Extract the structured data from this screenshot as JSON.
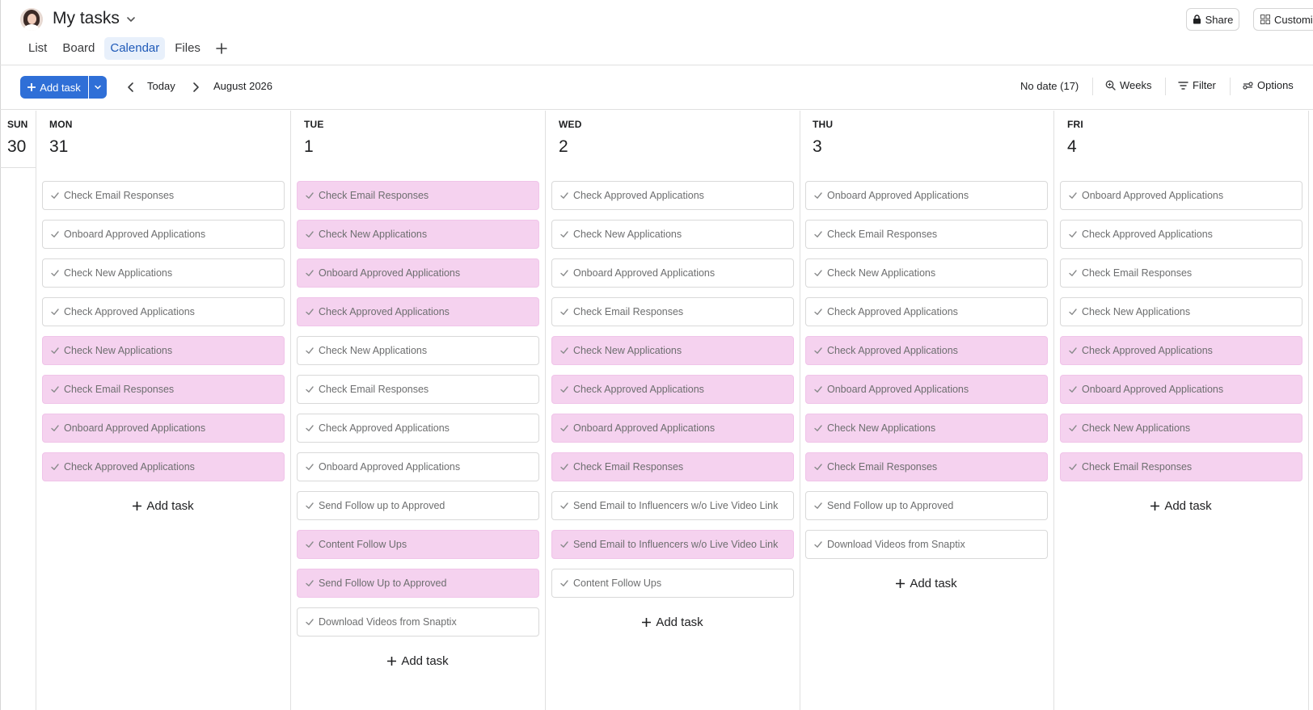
{
  "header": {
    "title": "My tasks",
    "share_label": "Share",
    "customize_label": "Customize"
  },
  "tabs": [
    {
      "label": "List",
      "active": false
    },
    {
      "label": "Board",
      "active": false
    },
    {
      "label": "Calendar",
      "active": true
    },
    {
      "label": "Files",
      "active": false
    }
  ],
  "toolbar": {
    "add_task_label": "Add task",
    "today_label": "Today",
    "month_label": "August 2026",
    "no_date_label": "No date (17)",
    "weeks_label": "Weeks",
    "filter_label": "Filter",
    "options_label": "Options"
  },
  "sunday": {
    "name": "SUN",
    "number": "30"
  },
  "add_task_label": "Add task",
  "colors": {
    "accent": "#2f6fd7",
    "task_highlight": "#f5d2ef",
    "active_tab_bg": "#e8f0fb"
  },
  "days": [
    {
      "name": "MON",
      "number": "31",
      "tasks": [
        {
          "title": "Check Email Responses",
          "highlight": false
        },
        {
          "title": "Onboard Approved Applications",
          "highlight": false
        },
        {
          "title": "Check New Applications",
          "highlight": false
        },
        {
          "title": "Check Approved Applications",
          "highlight": false
        },
        {
          "title": "Check New Applications",
          "highlight": true
        },
        {
          "title": "Check Email Responses",
          "highlight": true
        },
        {
          "title": "Onboard Approved Applications",
          "highlight": true
        },
        {
          "title": "Check Approved Applications",
          "highlight": true
        }
      ]
    },
    {
      "name": "TUE",
      "number": "1",
      "tasks": [
        {
          "title": "Check Email Responses",
          "highlight": true
        },
        {
          "title": "Check New Applications",
          "highlight": true
        },
        {
          "title": "Onboard Approved Applications",
          "highlight": true
        },
        {
          "title": "Check Approved Applications",
          "highlight": true
        },
        {
          "title": "Check New Applications",
          "highlight": false
        },
        {
          "title": "Check Email Responses",
          "highlight": false
        },
        {
          "title": "Check Approved Applications",
          "highlight": false
        },
        {
          "title": "Onboard Approved Applications",
          "highlight": false
        },
        {
          "title": "Send Follow up to Approved",
          "highlight": false
        },
        {
          "title": "Content Follow Ups",
          "highlight": true
        },
        {
          "title": "Send Follow Up to Approved",
          "highlight": true
        },
        {
          "title": "Download Videos from Snaptix",
          "highlight": false
        }
      ]
    },
    {
      "name": "WED",
      "number": "2",
      "tasks": [
        {
          "title": "Check Approved Applications",
          "highlight": false
        },
        {
          "title": "Check New Applications",
          "highlight": false
        },
        {
          "title": "Onboard Approved Applications",
          "highlight": false
        },
        {
          "title": "Check Email Responses",
          "highlight": false
        },
        {
          "title": "Check New Applications",
          "highlight": true
        },
        {
          "title": "Check Approved Applications",
          "highlight": true
        },
        {
          "title": "Onboard Approved Applications",
          "highlight": true
        },
        {
          "title": "Check Email Responses",
          "highlight": true
        },
        {
          "title": "Send Email to Influencers w/o Live Video Link",
          "highlight": false
        },
        {
          "title": "Send Email to Influencers w/o Live Video Link",
          "highlight": true
        },
        {
          "title": "Content Follow Ups",
          "highlight": false
        }
      ]
    },
    {
      "name": "THU",
      "number": "3",
      "tasks": [
        {
          "title": "Onboard Approved Applications",
          "highlight": false
        },
        {
          "title": "Check Email Responses",
          "highlight": false
        },
        {
          "title": "Check New Applications",
          "highlight": false
        },
        {
          "title": "Check Approved Applications",
          "highlight": false
        },
        {
          "title": "Check Approved Applications",
          "highlight": true
        },
        {
          "title": "Onboard Approved Applications",
          "highlight": true
        },
        {
          "title": "Check New Applications",
          "highlight": true
        },
        {
          "title": "Check Email Responses",
          "highlight": true
        },
        {
          "title": "Send Follow up to Approved",
          "highlight": false
        },
        {
          "title": "Download Videos from Snaptix",
          "highlight": false
        }
      ]
    },
    {
      "name": "FRI",
      "number": "4",
      "tasks": [
        {
          "title": "Onboard Approved Applications",
          "highlight": false
        },
        {
          "title": "Check Approved Applications",
          "highlight": false
        },
        {
          "title": "Check Email Responses",
          "highlight": false
        },
        {
          "title": "Check New Applications",
          "highlight": false
        },
        {
          "title": "Check Approved Applications",
          "highlight": true
        },
        {
          "title": "Onboard Approved Applications",
          "highlight": true
        },
        {
          "title": "Check New Applications",
          "highlight": true
        },
        {
          "title": "Check Email Responses",
          "highlight": true
        }
      ]
    }
  ]
}
